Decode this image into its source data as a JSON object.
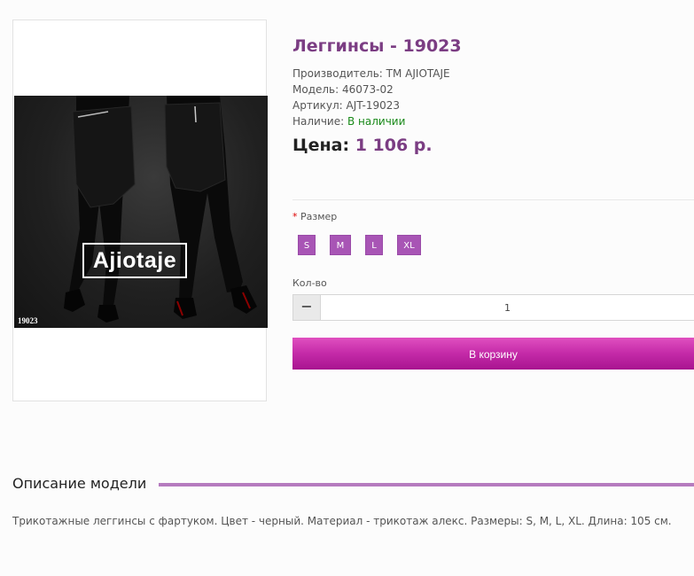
{
  "product": {
    "title": "Леггинсы - 19023",
    "manufacturer_label": "Производитель:",
    "manufacturer_value": "TM AJIOTAJE",
    "model_label": "Модель:",
    "model_value": "46073-02",
    "sku_label": "Артикул:",
    "sku_value": "AJT-19023",
    "availability_label": "Наличие:",
    "availability_value": "В наличии",
    "price_label": "Цена:",
    "price_value": "1 106 р."
  },
  "photo": {
    "logo_text": "Ajiotaje",
    "code_text": "19023"
  },
  "options": {
    "required_mark": "*",
    "size_label": "Размер",
    "sizes": [
      "S",
      "M",
      "L",
      "XL"
    ]
  },
  "quantity": {
    "label": "Кол-во",
    "minus_symbol": "−",
    "value": "1"
  },
  "cart": {
    "button_label": "В корзину"
  },
  "description": {
    "heading": "Описание модели",
    "text": "Трикотажные леггинсы с фартуком. Цвет - черный. Материал - трикотаж алекс. Размеры: S, M, L, XL. Длина: 105 см."
  },
  "colors": {
    "accent": "#7b3d83",
    "size_button": "#a855b5",
    "cart_button": "#c42aa8",
    "in_stock": "#1a8a1a"
  }
}
